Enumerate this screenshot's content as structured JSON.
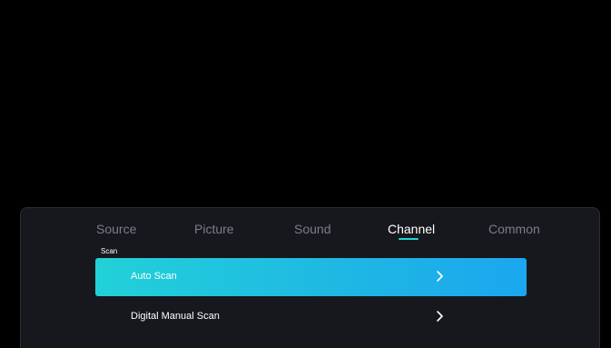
{
  "menu": {
    "tabs": [
      {
        "label": "Source"
      },
      {
        "label": "Picture"
      },
      {
        "label": "Sound"
      },
      {
        "label": "Channel"
      },
      {
        "label": "Common"
      }
    ],
    "active_tab": "Channel",
    "section_label": "Scan",
    "items": [
      {
        "label": "Auto Scan",
        "icon": "chevron-right-icon",
        "selected": true
      },
      {
        "label": "Digital Manual Scan",
        "icon": "chevron-right-icon",
        "selected": false
      }
    ]
  },
  "colors": {
    "background": "#000000",
    "panel": "#16181e",
    "tab_inactive": "#7b7e86",
    "tab_active": "#ffffff",
    "accent": "#1fd6d6",
    "selected_gradient_start": "#22d1d8",
    "selected_gradient_end": "#1ba7ee"
  }
}
